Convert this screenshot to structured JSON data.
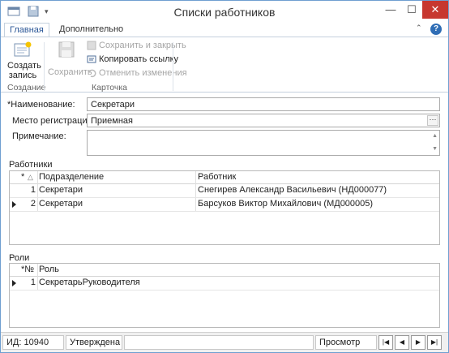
{
  "window": {
    "title": "Списки работников"
  },
  "tabs": [
    {
      "label": "Главная"
    },
    {
      "label": "Дополнительно"
    }
  ],
  "ribbon": {
    "create_label_1": "Создать",
    "create_label_2": "запись",
    "save_label": "Сохранить",
    "save_close_label": "Сохранить и закрыть",
    "copy_link_label": "Копировать ссылку",
    "undo_label": "Отменить изменения",
    "group_create": "Создание",
    "group_card": "Карточка"
  },
  "form": {
    "name_label": "*Наименование:",
    "name_value": "Секретари",
    "place_label": "Место регистрации:",
    "place_value": "Приемная",
    "note_label": "Примечание:",
    "note_value": ""
  },
  "workers": {
    "section_title": "Работники",
    "columns": {
      "num": "*",
      "sort": "△",
      "dept": "Подразделение",
      "worker": "Работник"
    },
    "rows": [
      {
        "num": "1",
        "dept": "Секретари",
        "worker": "Снегирев Александр Васильевич (НД000077)"
      },
      {
        "num": "2",
        "dept": "Секретари",
        "worker": "Барсуков Виктор Михайлович (МД000005)"
      }
    ]
  },
  "roles": {
    "section_title": "Роли",
    "columns": {
      "num": "*№",
      "role": "Роль"
    },
    "rows": [
      {
        "num": "1",
        "role": "СекретарьРуководителя"
      }
    ]
  },
  "status": {
    "id_text": "ИД: 10940",
    "state_text": "Утверждена",
    "mode_text": "Просмотр"
  },
  "colors": {
    "accent": "#2b5797",
    "close": "#c7372f"
  }
}
